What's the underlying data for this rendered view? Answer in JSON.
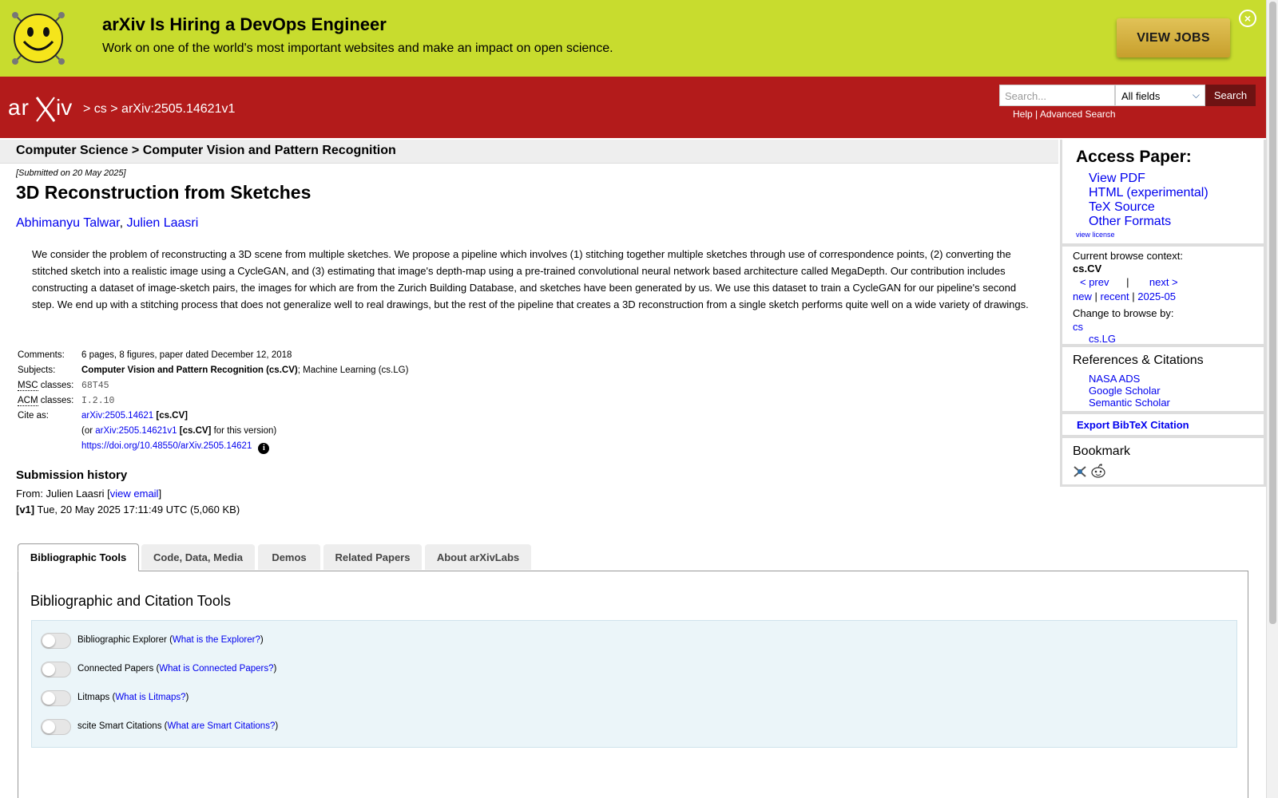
{
  "banner": {
    "title": "arXiv Is Hiring a DevOps Engineer",
    "subtitle": "Work on one of the world's most important websites and make an impact on open science.",
    "button": "VIEW JOBS",
    "close": "×"
  },
  "header": {
    "logo_alt": "arXiv",
    "crumb_sep1": ">",
    "crumb_cs": "cs",
    "crumb_sep2": ">",
    "crumb_id": "arXiv:2505.14621v1",
    "search_placeholder": "Search...",
    "search_field": "All fields",
    "search_button": "Search",
    "help": "Help",
    "link_sep": "|",
    "advanced": "Advanced Search"
  },
  "subheader": "Computer Science > Computer Vision and Pattern Recognition",
  "paper": {
    "submitted": "[Submitted on 20 May 2025]",
    "title": "3D Reconstruction from Sketches",
    "author1": "Abhimanyu Talwar",
    "author_sep": ",",
    "author2": "Julien Laasri",
    "abstract": "We consider the problem of reconstructing a 3D scene from multiple sketches. We propose a pipeline which involves (1) stitching together multiple sketches through use of correspondence points, (2) converting the stitched sketch into a realistic image using a CycleGAN, and (3) estimating that image's depth-map using a pre-trained convolutional neural network based architecture called MegaDepth. Our contribution includes constructing a dataset of image-sketch pairs, the images for which are from the Zurich Building Database, and sketches have been generated by us. We use this dataset to train a CycleGAN for our pipeline's second step. We end up with a stitching process that does not generalize well to real drawings, but the rest of the pipeline that creates a 3D reconstruction from a single sketch performs quite well on a wide variety of drawings."
  },
  "meta": {
    "comments_label": "Comments:",
    "comments": "6 pages, 8 figures, paper dated December 12, 2018",
    "subjects_label": "Subjects:",
    "subject_primary": "Computer Vision and Pattern Recognition (cs.CV)",
    "subject_rest": "; Machine Learning (cs.LG)",
    "msc_abbr": "MSC",
    "msc_label": " classes:",
    "msc": "68T45",
    "acm_abbr": "ACM",
    "acm_label": " classes:",
    "acm": "I.2.10",
    "cite_label": "Cite as:",
    "cite_id": "arXiv:2505.14621",
    "cite_cat": "[cs.CV]",
    "cite_or": "(or ",
    "cite_v_id": "arXiv:2505.14621v1",
    "cite_v_cat": "[cs.CV]",
    "cite_v_tail": " for this version)",
    "doi": "https://doi.org/10.48550/arXiv.2505.14621",
    "info": "i"
  },
  "history": {
    "heading": "Submission history",
    "from_prefix": "From: Julien Laasri [",
    "view_email": "view email",
    "from_suffix": "]",
    "v1_label": "[v1]",
    "v1_text": " Tue, 20 May 2025 17:11:49 UTC (5,060 KB)"
  },
  "sidebar": {
    "access_title": "Access Paper:",
    "view_pdf": "View PDF",
    "html": "HTML (experimental)",
    "tex": "TeX Source",
    "other": "Other Formats",
    "license": "view license",
    "ctx_label": "Current browse context:",
    "ctx_value": "cs.CV",
    "prev": "< prev",
    "sep": "|",
    "next": "next >",
    "new": "new",
    "recent": "recent",
    "month": "2025-05",
    "change_label": "Change to browse by:",
    "browse_cs": "cs",
    "browse_lg": "cs.LG",
    "refs_title": "References & Citations",
    "nasa": "NASA ADS",
    "google": "Google Scholar",
    "semantic": "Semantic Scholar",
    "bibtex": "Export BibTeX Citation",
    "bookmark_title": "Bookmark"
  },
  "tabs": [
    "Bibliographic Tools",
    "Code, Data, Media",
    "Demos",
    "Related Papers",
    "About arXivLabs"
  ],
  "panel": {
    "title": "Bibliographic and Citation Tools",
    "tools": [
      {
        "name": "Bibliographic Explorer",
        "link": "What is the Explorer?"
      },
      {
        "name": "Connected Papers",
        "link": "What is Connected Papers?"
      },
      {
        "name": "Litmaps",
        "link": "What is Litmaps?"
      },
      {
        "name": "scite Smart Citations",
        "link": "What are Smart Citations?"
      }
    ]
  },
  "colors": {
    "banner_bg": "#c8dc2e",
    "header_bg": "#b31b1b",
    "link": "#0000ee",
    "tools_bg": "#ebf5f9"
  }
}
